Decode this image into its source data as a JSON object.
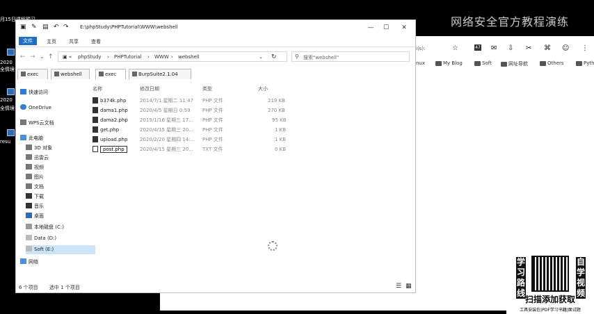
{
  "desktop": {
    "items": [
      "月15日课程预习",
      "2020",
      "全情境",
      "2020",
      "全情境",
      "resu"
    ]
  },
  "watermark": "网络安全官方教程演练",
  "browser": {
    "address_fragment": "i(s):",
    "badge": "47",
    "bookmarks": [
      "inux",
      "My Blog",
      "Soft",
      "网址导航",
      "Others",
      "Pyth"
    ]
  },
  "explorer": {
    "title": "E:\\phpStudy\\PHPTutorial\\WWW\\webshell",
    "window_controls": [
      "—",
      "☐",
      "✕"
    ],
    "ribbon_tabs": [
      "文件",
      "主页",
      "共享",
      "查看"
    ],
    "breadcrumb": [
      "phpStudy",
      "PHPTutorial",
      "WWW",
      "webshell"
    ],
    "search_placeholder": "搜索\"webshell\"",
    "tabs": [
      "exec",
      "webshell",
      "exec",
      "BurpSuite2.1.04"
    ],
    "nav_items": [
      "快速访问",
      "OneDrive",
      "WPS云文档",
      "此电脑",
      "3D 对象",
      "迅雷云",
      "视频",
      "图片",
      "文档",
      "下载",
      "音乐",
      "桌面",
      "本地磁盘 (C:)",
      "Data (D:)",
      "Soft (E:)",
      "网络"
    ],
    "columns": [
      "名称",
      "修改日期",
      "类型",
      "大小"
    ],
    "files": [
      {
        "name": "b374k.php",
        "date": "2014/7/1 星期二 11:47",
        "type": "PHP 文件",
        "size": "219 KB"
      },
      {
        "name": "dama1.php",
        "date": "2020/4/5 星期日 0:59",
        "type": "PHP 文件",
        "size": "270 KB"
      },
      {
        "name": "dama2.php",
        "date": "2019/1/16 星期三 17...",
        "type": "PHP 文件",
        "size": "95 KB"
      },
      {
        "name": "get.php",
        "date": "2020/4/15 星期三 20...",
        "type": "PHP 文件",
        "size": "1 KB"
      },
      {
        "name": "upload.php",
        "date": "2020/2/20 星期四 14:...",
        "type": "PHP 文件",
        "size": "1 KB"
      },
      {
        "name": "post.php",
        "date": "2020/4/15 星期三 20...",
        "type": "TXT 文件",
        "size": "0 KB"
      }
    ],
    "status_count": "6 个项目",
    "status_selected": "选中 1 个项目"
  },
  "ad": {
    "left_text": "学习路线",
    "right_text": "自学视频",
    "cta": "扫描添加获取",
    "small": "工具安装包|PDF学习书籍|面试题"
  }
}
